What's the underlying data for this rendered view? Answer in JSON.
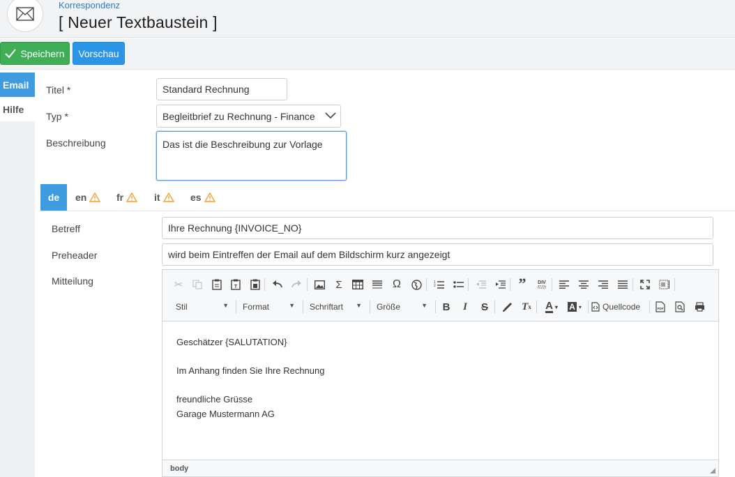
{
  "header": {
    "breadcrumb": "Korrespondenz",
    "title": "[ Neuer Textbaustein ]",
    "icon": "envelope-icon"
  },
  "toolbar": {
    "save_label": "Speichern",
    "preview_label": "Vorschau"
  },
  "sidetabs": [
    {
      "label": "Email",
      "active": true
    },
    {
      "label": "Hilfe",
      "active": false
    }
  ],
  "form": {
    "titel_label": "Titel *",
    "titel_value": "Standard Rechnung",
    "typ_label": "Typ *",
    "typ_value": "Begleitbrief zu Rechnung - Finance",
    "beschreibung_label": "Beschreibung",
    "beschreibung_value": "Das ist die Beschreibung zur Vorlage"
  },
  "languages": [
    {
      "code": "de",
      "active": true,
      "warning": false
    },
    {
      "code": "en",
      "active": false,
      "warning": true
    },
    {
      "code": "fr",
      "active": false,
      "warning": true
    },
    {
      "code": "it",
      "active": false,
      "warning": true
    },
    {
      "code": "es",
      "active": false,
      "warning": true
    }
  ],
  "email": {
    "betreff_label": "Betreff",
    "betreff_value": "Ihre Rechnung {INVOICE_NO}",
    "preheader_label": "Preheader",
    "preheader_value": "wird beim Eintreffen der Email auf dem Bildschirm kurz angezeigt",
    "mitteilung_label": "Mitteilung"
  },
  "editor": {
    "combos": {
      "stil": "Stil",
      "format": "Format",
      "schriftart": "Schriftart",
      "groesse": "Größe"
    },
    "quellcode_label": "Quellcode",
    "content": {
      "line1": "Geschätzer {SALUTATION}",
      "line2": "Im Anhang finden Sie Ihre Rechnung",
      "line3": "freundliche Grüsse",
      "line4": "Garage Mustermann AG"
    },
    "status_path": "body"
  },
  "colors": {
    "accent": "#3e9be0",
    "save_green": "#3fae56",
    "warning": "#f0a030",
    "link": "#2a7bd4"
  }
}
